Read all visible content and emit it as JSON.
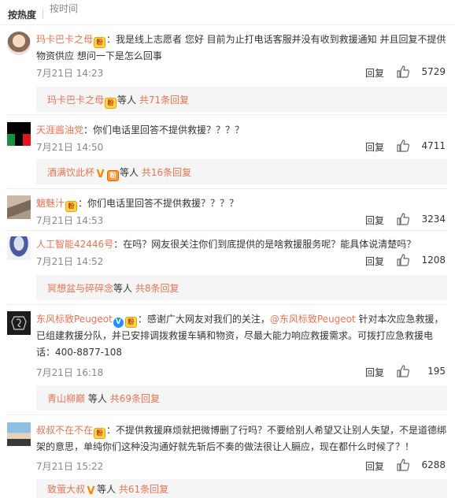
{
  "sort_bar": {
    "hot": "按热度",
    "time": "按时间"
  },
  "comments": [
    {
      "user": "玛卡巴卡之母",
      "text": "：我是线上志愿者 您好 目前为止打电话客服并没有收到救援通知 并且回复不提供物资供应 想问一下是怎么回事",
      "time": "7月21日 14:23",
      "reply": "回复",
      "likes": "5729",
      "sub_user": "玛卡巴卡之母",
      "sub_mid": "等人",
      "sub_count": "共71条回复"
    },
    {
      "user": "天涯酱油党",
      "text": "：你们电话里回答不提供救援？？？？",
      "time": "7月21日 14:50",
      "reply": "回复",
      "likes": "4711",
      "sub_user": "酒满饮此杯",
      "sub_mid": "等人",
      "sub_count": "共16条回复"
    },
    {
      "user": "魑魅汁",
      "text": "：你们电话里回答不提供救援？？？？",
      "time": "7月21日 14:53",
      "reply": "回复",
      "likes": "3234"
    },
    {
      "user": "人工智能42446号",
      "text": "：在吗？网友很关注你们到底提供的是啥救援服务呢？能具体说清楚吗？",
      "time": "7月21日 14:52",
      "reply": "回复",
      "likes": "1208",
      "sub_user": "冥想盆与碎碎念",
      "sub_mid": "等人",
      "sub_count": "共8条回复"
    },
    {
      "user": "东风标致Peugeot",
      "text_a": "：感谢广大网友对我们的关注，",
      "mention": "@东风标致Peugeot",
      "text_b": " 针对本次应急救援，已组建救援分队，并已安排调拨救援车辆和物资，尽最大能力响应救援需求。可拨打应急救援电话：400-8877-108",
      "time": "7月21日 16:18",
      "reply": "回复",
      "likes": "195",
      "sub_user": "青山柳巅",
      "sub_mid": "等人",
      "sub_count": "共69条回复"
    },
    {
      "user": "叔叔不在不在",
      "text": "：不提供救援麻烦就把微博删了行吗？不要给别人希望又让别人失望，不是道德绑架的意思，单纯你们这种没沟通好就先斩后不奏的做法很让人膈应，现在都什么时候了？！",
      "time": "7月21日 15:22",
      "reply": "回复",
      "likes": "6288",
      "sub_user": "致萤大叔",
      "sub_mid": "等人",
      "sub_count": "共61条回复"
    }
  ],
  "colors": {
    "accent": "#eb7350",
    "meta": "#888888",
    "sub_bg": "#f5f5f5"
  },
  "icons": {
    "like": "thumbs-up-icon",
    "verified": "verified-v-icon",
    "fan_badge": "fan-badge-icon"
  }
}
